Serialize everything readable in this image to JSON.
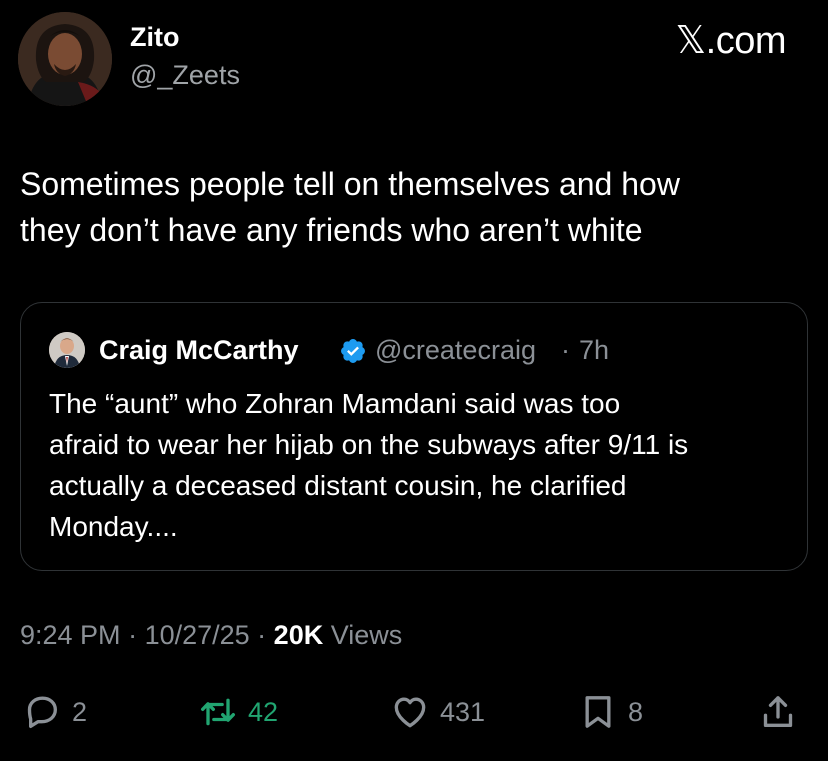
{
  "author": {
    "name": "Zito",
    "handle": "@_Zeets"
  },
  "site_label": "𝕏.com",
  "tweet": {
    "text_line1": "Sometimes people tell on themselves and how",
    "text_line2": "they don’t have any friends who aren’t white"
  },
  "quote": {
    "name": "Craig McCarthy",
    "handle": "@createcraig",
    "separator": "·",
    "time": "7h",
    "text_line1": "The “aunt” who Zohran Mamdani said was too",
    "text_line2": "afraid to wear her hijab on the subways after 9/11 is",
    "text_line3": "actually a deceased distant cousin, he clarified",
    "text_line4": "Monday...."
  },
  "meta": {
    "time": "9:24 PM",
    "sep1": " · ",
    "date": "10/27/25",
    "sep2": " · ",
    "views_count": "20K",
    "views_label": " Views"
  },
  "actions": {
    "reply_count": "2",
    "repost_count": "42",
    "like_count": "431",
    "bookmark_count": "8"
  },
  "colors": {
    "background": "#000000",
    "text": "#ffffff",
    "secondary": "#8b9096",
    "verified": "#1d9bf0",
    "repost": "#21a571",
    "border": "#2f3336"
  },
  "icons": {
    "reply": "speech-bubble-icon",
    "repost": "repost-arrows-icon",
    "like": "heart-icon",
    "bookmark": "bookmark-icon",
    "share": "share-upload-icon",
    "verified": "verified-badge-icon"
  }
}
